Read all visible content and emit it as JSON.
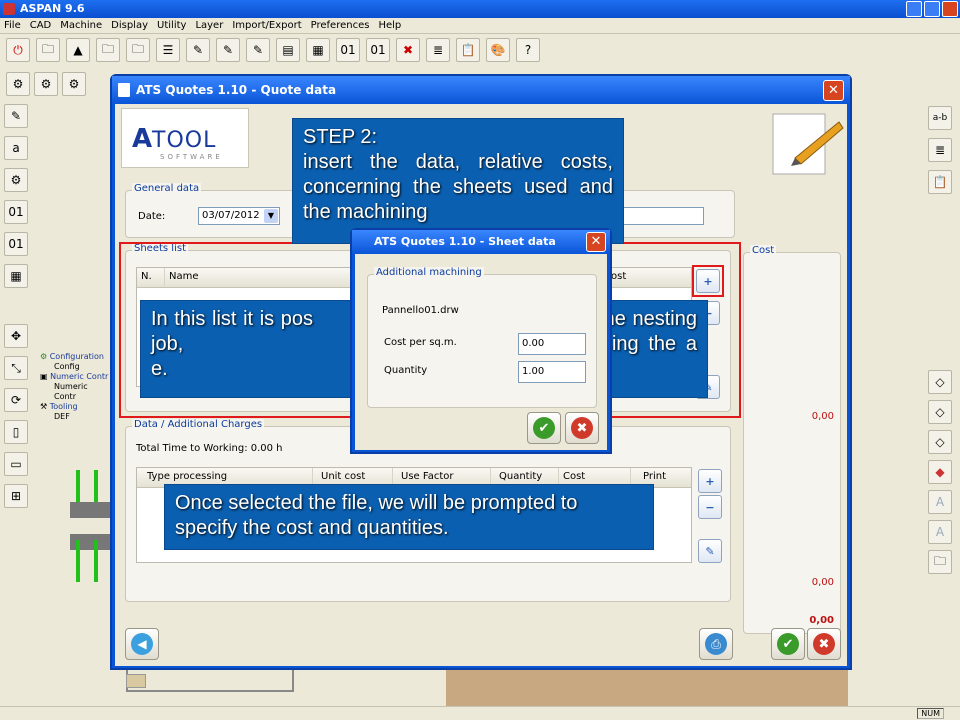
{
  "app": {
    "title": "ASPAN 9.6",
    "menu": [
      "File",
      "CAD",
      "Machine",
      "Display",
      "Utility",
      "Layer",
      "Import/Export",
      "Preferences",
      "Help"
    ]
  },
  "tree": {
    "configuration": "Configuration",
    "config": "Config",
    "numeric_control_1": "Numeric Contr",
    "numeric_control_2": "Numeric Contr",
    "tooling": "Tooling",
    "tooling_value": "DEF"
  },
  "dialog": {
    "title": "ATS Quotes 1.10 - Quote data",
    "general": {
      "title": "General data",
      "date_label": "Date:",
      "date_value": "03/07/2012"
    },
    "sheets": {
      "title": "Sheets list",
      "columns": [
        "N.",
        "Name",
        "ost"
      ]
    },
    "cost": {
      "title": "Cost",
      "value1": "0,00",
      "value2": "0,00",
      "value3": "0,00"
    },
    "charges": {
      "title": "Data / Additional Charges",
      "total_time": "Total Time to Working: 0.00 h",
      "columns": [
        "Type processing",
        "Unit cost",
        "Use Factor",
        "Quantity",
        "Cost",
        "Print"
      ]
    }
  },
  "sheet_dialog": {
    "title": "ATS Quotes 1.10 - Sheet data",
    "group": "Additional machining",
    "file": "Pannello01.drw",
    "cost_label": "Cost per sq.m.",
    "cost_value": "0.00",
    "quantity_label": "Quantity",
    "quantity_value": "1.00"
  },
  "callouts": {
    "step2": "STEP 2:\ninsert the data, relative costs, concerning the sheets used and the machining",
    "list": "In this list it is pos                          ets used for the nesting job,                          e .DRW format, using the a                          e.",
    "prompt": "Once selected the file, we will be prompted to specify the cost and quantities."
  },
  "status": {
    "num": "NUM"
  },
  "colors": {
    "titlebar": "#0a55d6",
    "callout": "#0b5fb0",
    "highlight": "#e01a1a"
  }
}
